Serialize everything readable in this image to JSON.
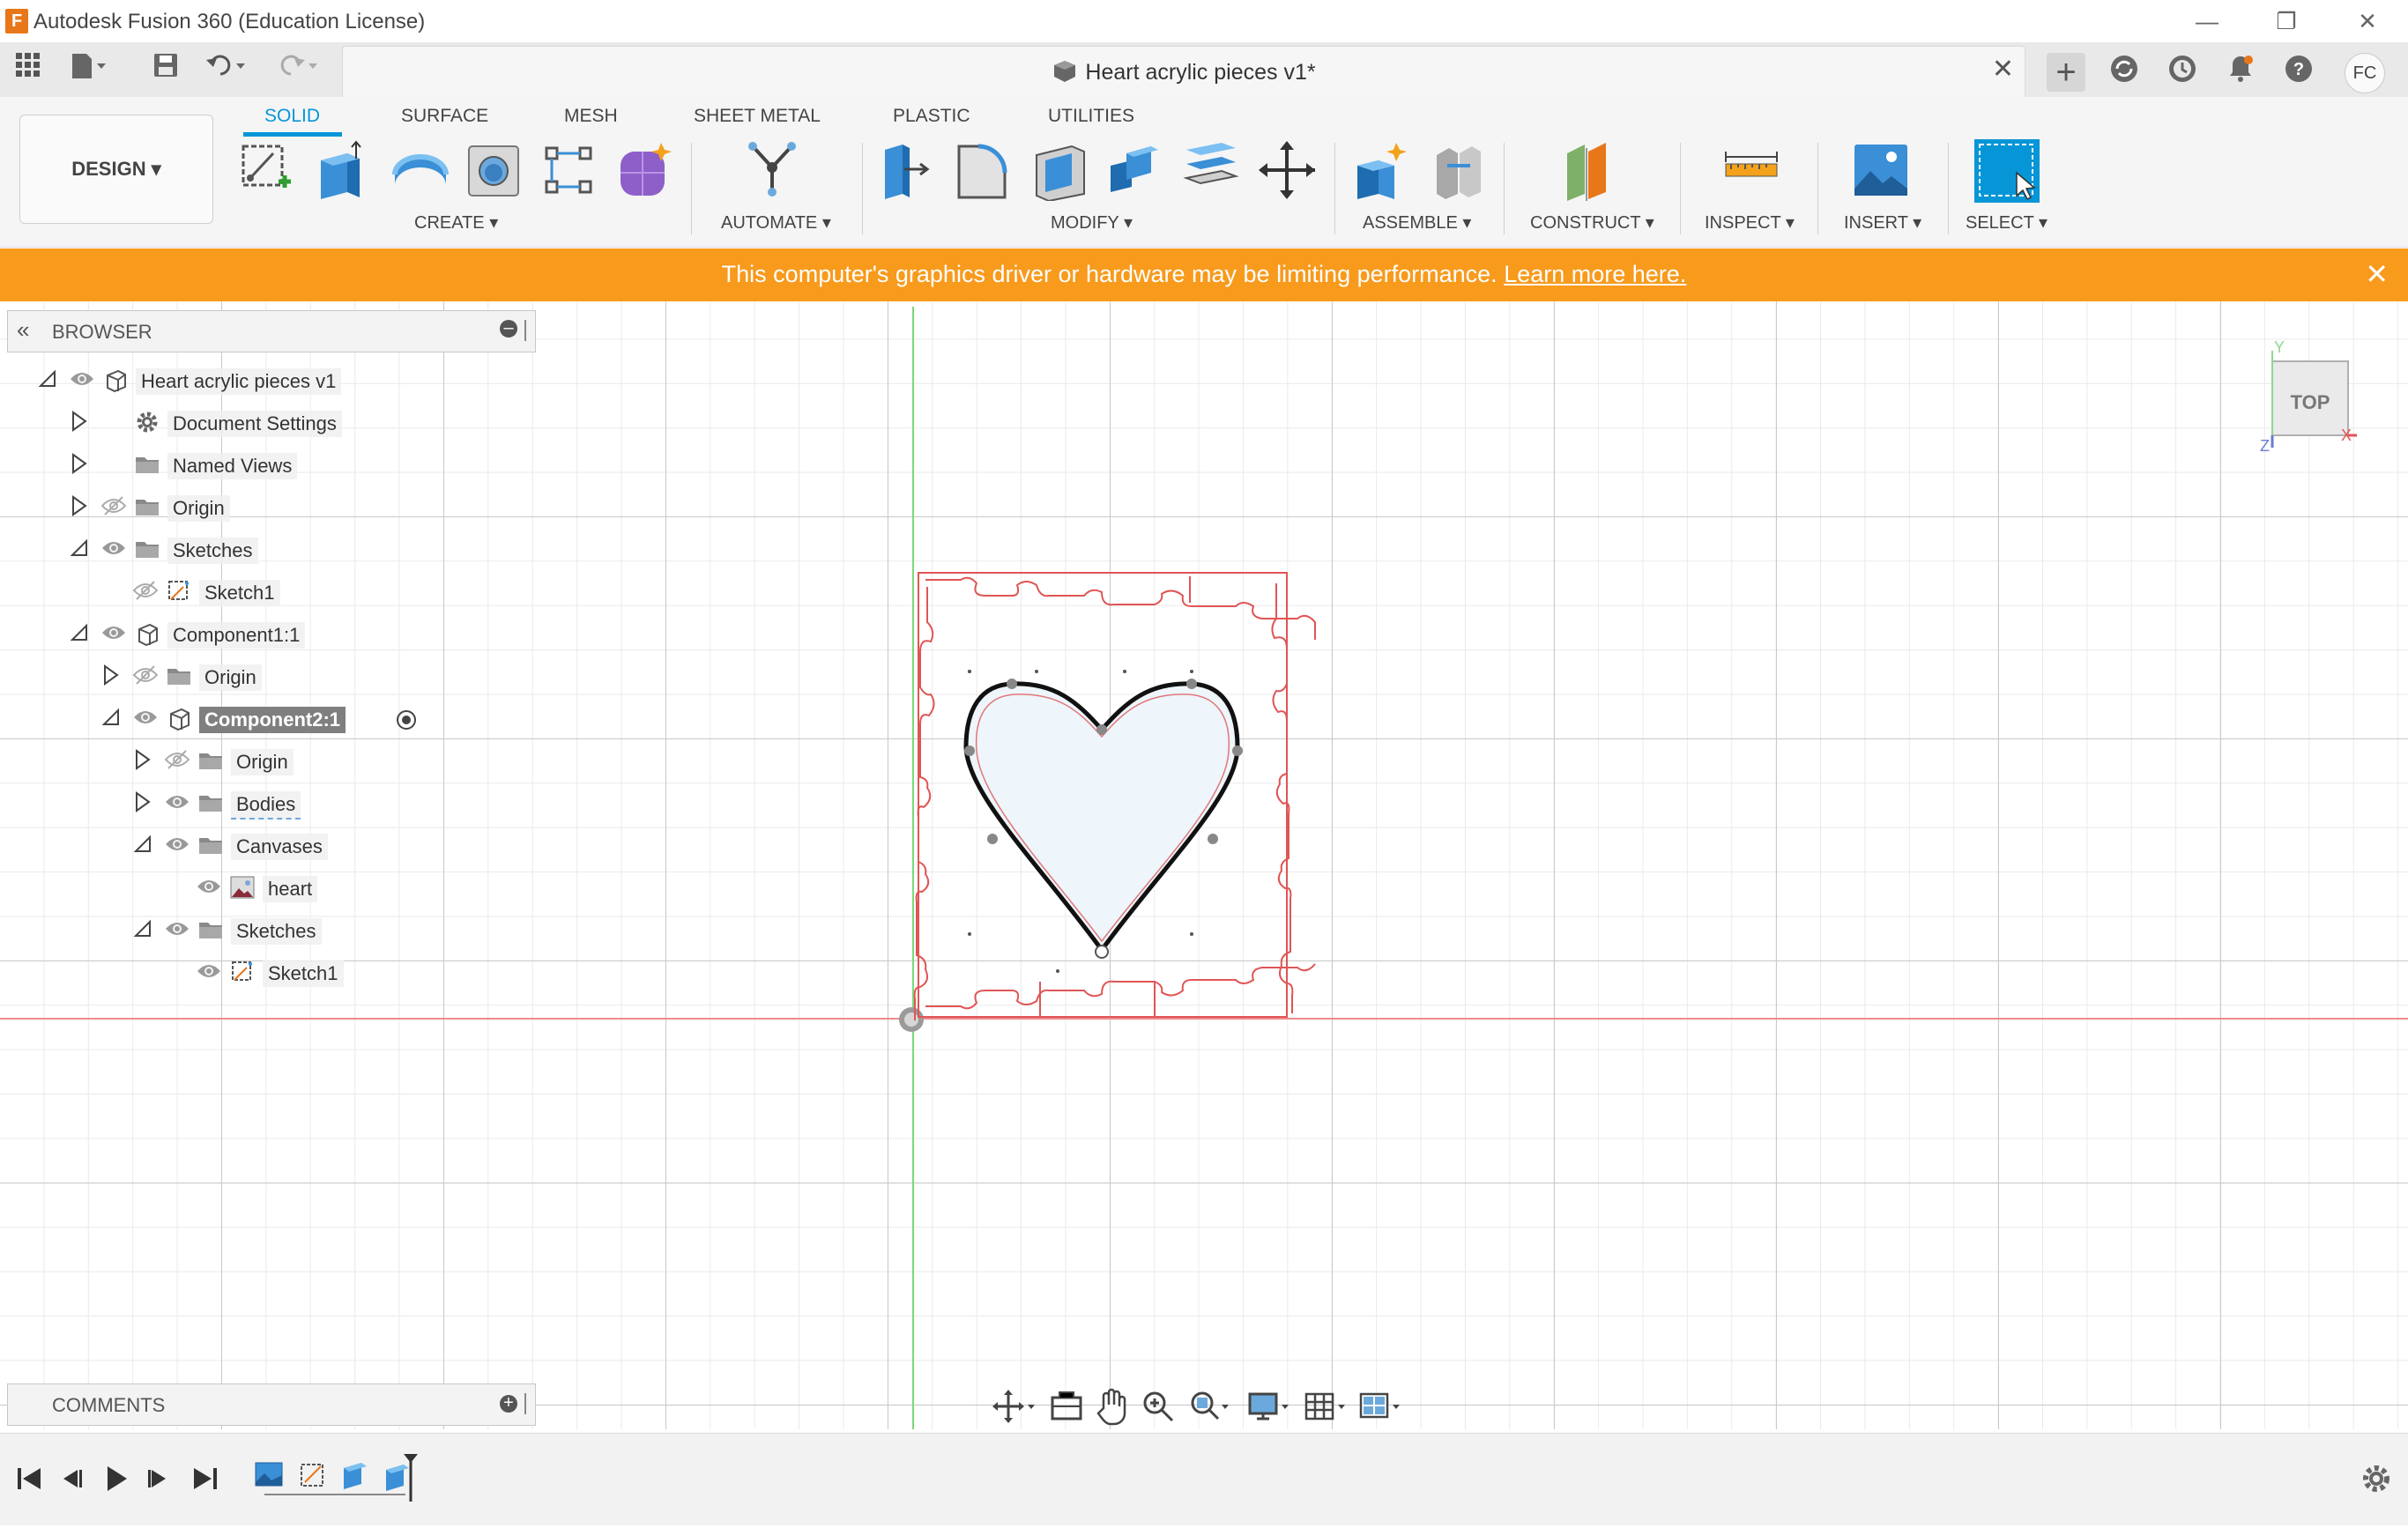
{
  "app": {
    "title": "Autodesk Fusion 360 (Education License)"
  },
  "document": {
    "name": "Heart acrylic pieces v1*"
  },
  "user": {
    "initials": "FC"
  },
  "workspace": {
    "label": "DESIGN"
  },
  "tabs": [
    "SOLID",
    "SURFACE",
    "MESH",
    "SHEET METAL",
    "PLASTIC",
    "UTILITIES"
  ],
  "groups": {
    "create": "CREATE",
    "automate": "AUTOMATE",
    "modify": "MODIFY",
    "assemble": "ASSEMBLE",
    "construct": "CONSTRUCT",
    "inspect": "INSPECT",
    "insert": "INSERT",
    "select": "SELECT"
  },
  "banner": {
    "message": "This computer's graphics driver or hardware may be limiting performance.",
    "link": "Learn more here."
  },
  "browser": {
    "header": "BROWSER",
    "nodes": [
      {
        "label": "Heart acrylic pieces v1"
      },
      {
        "label": "Document Settings"
      },
      {
        "label": "Named Views"
      },
      {
        "label": "Origin"
      },
      {
        "label": "Sketches"
      },
      {
        "label": "Sketch1"
      },
      {
        "label": "Component1:1"
      },
      {
        "label": "Origin"
      },
      {
        "label": "Component2:1"
      },
      {
        "label": "Origin"
      },
      {
        "label": "Bodies"
      },
      {
        "label": "Canvases"
      },
      {
        "label": "heart"
      },
      {
        "label": "Sketches"
      },
      {
        "label": "Sketch1"
      }
    ]
  },
  "comments": {
    "header": "COMMENTS"
  },
  "viewcube": {
    "face": "TOP",
    "axis_x": "X",
    "axis_y": "Y",
    "axis_z": "Z"
  },
  "colors": {
    "accent": "#0696d7",
    "banner": "#f89a1c",
    "sketch_red": "#e05555"
  }
}
